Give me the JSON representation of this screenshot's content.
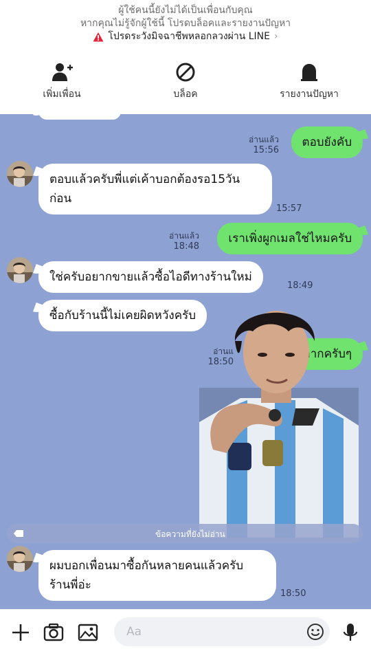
{
  "header": {
    "notice_line1": "ผู้ใช้คนนี้ยังไม่ได้เป็นเพื่อนกับคุณ",
    "notice_line2": "หากคุณไม่รู้จักผู้ใช้นี้ โปรดบล็อคและรายงานปัญหา",
    "warning_text": "โปรดระวังมิจฉาชีพหลอกลวงผ่าน LINE",
    "actions": [
      {
        "label": "เพิ่มเพื่อน",
        "icon": "add-friend-icon"
      },
      {
        "label": "บล็อค",
        "icon": "block-icon"
      },
      {
        "label": "รายงานปัญหา",
        "icon": "report-icon"
      }
    ]
  },
  "messages": [
    {
      "side": "out",
      "text": "ตอบยังคับ",
      "read": "อ่านแล้ว",
      "time": "15:56"
    },
    {
      "side": "in",
      "text": "ตอบแล้วครับพี่แต่เค้าบอกต้องรอ15วันก่อน",
      "line1": "ตอบแล้วครับพี่แต่เค้าบอกต้องรอ15วัน",
      "line2": "ก่อน",
      "time": "15:57"
    },
    {
      "side": "out",
      "text": "เราเพิ่งผูกเมลใช่ไหมครับ",
      "read": "อ่านแล้ว",
      "time": "18:48"
    },
    {
      "side": "in",
      "text": "ใช่ครับอยากขายแล้วซื้อไอดีทางร้านใหม่",
      "time": "18:49"
    },
    {
      "side": "in",
      "text": "ซื้อกับร้านนี้ไม่เคยผิดหวังครับ",
      "time": ""
    },
    {
      "side": "out",
      "text": "าากครับๆ",
      "read": "อ่านแ",
      "time": "18:50"
    },
    {
      "side": "in",
      "text": "ผมบอกเพื่อนมาซื้อกันหลายคนแล้วครับร้านพี่อ่ะ",
      "line1": "ผมบอกเพื่อนมาซื้อกันหลายคนแล้วครับ",
      "line2": "ร้านพี่อ่ะ",
      "time": "18:50"
    }
  ],
  "unread_label": "ข้อความที่ยังไม่อ่าน",
  "input": {
    "placeholder": "Aa"
  },
  "colors": {
    "chat_bg": "#8da2d3",
    "out_bubble": "#6fe36e",
    "in_bubble": "#ffffff",
    "warning": "#e0263a"
  }
}
